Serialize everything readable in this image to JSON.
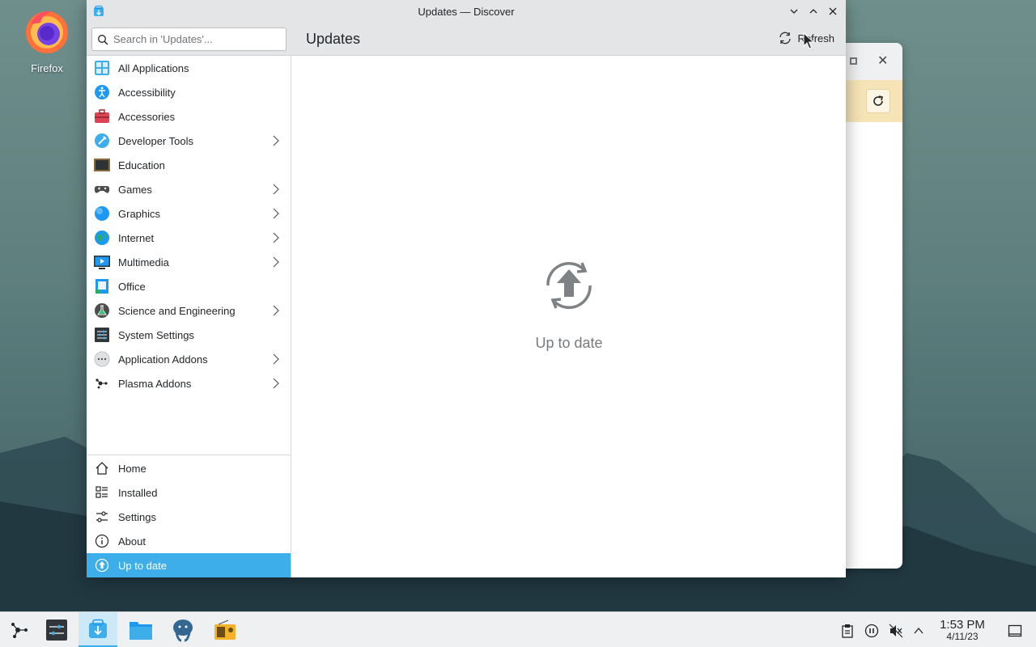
{
  "desktop": {
    "icons": [
      {
        "label": "Firefox",
        "icon": "firefox-icon"
      }
    ]
  },
  "window": {
    "title": "Updates — Discover",
    "icon": "discover-icon",
    "controls": [
      "minimize-icon",
      "maximize-icon",
      "close-icon"
    ]
  },
  "toolbar": {
    "search_placeholder": "Search in 'Updates'...",
    "page_title": "Updates",
    "refresh_label": "Refresh"
  },
  "sidebar": {
    "categories": [
      {
        "label": "All Applications",
        "icon": "all-applications-icon",
        "has_children": false
      },
      {
        "label": "Accessibility",
        "icon": "accessibility-icon",
        "has_children": false
      },
      {
        "label": "Accessories",
        "icon": "accessories-icon",
        "has_children": false
      },
      {
        "label": "Developer Tools",
        "icon": "developer-tools-icon",
        "has_children": true
      },
      {
        "label": "Education",
        "icon": "education-icon",
        "has_children": false
      },
      {
        "label": "Games",
        "icon": "games-icon",
        "has_children": true
      },
      {
        "label": "Graphics",
        "icon": "graphics-icon",
        "has_children": true
      },
      {
        "label": "Internet",
        "icon": "internet-icon",
        "has_children": true
      },
      {
        "label": "Multimedia",
        "icon": "multimedia-icon",
        "has_children": true
      },
      {
        "label": "Office",
        "icon": "office-icon",
        "has_children": false
      },
      {
        "label": "Science and Engineering",
        "icon": "science-icon",
        "has_children": true
      },
      {
        "label": "System Settings",
        "icon": "system-settings-icon",
        "has_children": false
      },
      {
        "label": "Application Addons",
        "icon": "application-addons-icon",
        "has_children": true
      },
      {
        "label": "Plasma Addons",
        "icon": "plasma-addons-icon",
        "has_children": true
      }
    ],
    "nav": [
      {
        "label": "Home",
        "icon": "home-icon",
        "active": false
      },
      {
        "label": "Installed",
        "icon": "installed-icon",
        "active": false
      },
      {
        "label": "Settings",
        "icon": "settings-icon",
        "active": false
      },
      {
        "label": "About",
        "icon": "info-icon",
        "active": false
      },
      {
        "label": "Up to date",
        "icon": "update-icon",
        "active": true
      }
    ]
  },
  "main": {
    "status_text": "Up to date",
    "status_icon": "up-to-date-icon"
  },
  "taskbar": {
    "tasks": [
      "application-launcher-icon",
      "system-settings-icon",
      "discover-icon",
      "file-manager-icon",
      "database-icon",
      "radio-icon"
    ],
    "tray": [
      "clipboard-icon",
      "media-pause-icon",
      "volume-muted-icon",
      "expand-tray-icon"
    ],
    "clock": {
      "time": "1:53 PM",
      "date": "4/11/23"
    },
    "show_desktop": "show-desktop-icon"
  },
  "colors": {
    "accent": "#3daee9",
    "window_chrome": "#e3e5e7",
    "text": "#232629",
    "muted_text": "#777a7d"
  }
}
